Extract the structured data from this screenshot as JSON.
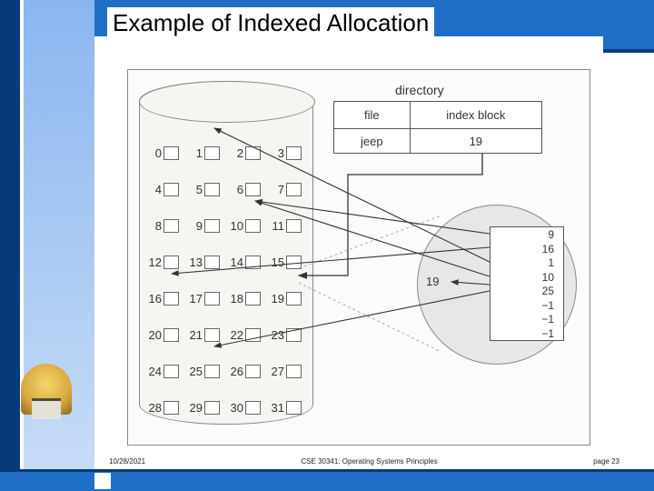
{
  "title": "Example of Indexed Allocation",
  "directory": {
    "label": "directory",
    "headers": {
      "col1": "file",
      "col2": "index block"
    },
    "row": {
      "file": "jeep",
      "index_block": "19"
    }
  },
  "disk": {
    "rows": [
      [
        "0",
        "1",
        "2",
        "3"
      ],
      [
        "4",
        "5",
        "6",
        "7"
      ],
      [
        "8",
        "9",
        "10",
        "11"
      ],
      [
        "12",
        "13",
        "14",
        "15"
      ],
      [
        "16",
        "17",
        "18",
        "19"
      ],
      [
        "20",
        "21",
        "22",
        "23"
      ],
      [
        "24",
        "25",
        "26",
        "27"
      ],
      [
        "28",
        "29",
        "30",
        "31"
      ]
    ]
  },
  "zoom": {
    "label": "19",
    "index_contents": [
      "9",
      "16",
      "1",
      "10",
      "25",
      "−1",
      "−1",
      "−1"
    ]
  },
  "chart_data": {
    "type": "diagram",
    "description": "Indexed file allocation on disk",
    "directory": [
      {
        "file": "jeep",
        "index_block": 19
      }
    ],
    "index_block": {
      "block": 19,
      "pointers": [
        9,
        16,
        1,
        10,
        25,
        -1,
        -1,
        -1
      ]
    },
    "disk_blocks_total": 32,
    "arrows_from_index_to_blocks": [
      9,
      16,
      1,
      10,
      25
    ],
    "arrow_from_directory_to_block": 19
  },
  "footer": {
    "date": "10/28/2021",
    "course": "CSE 30341: Operating Systems Principles",
    "page": "page 23"
  }
}
